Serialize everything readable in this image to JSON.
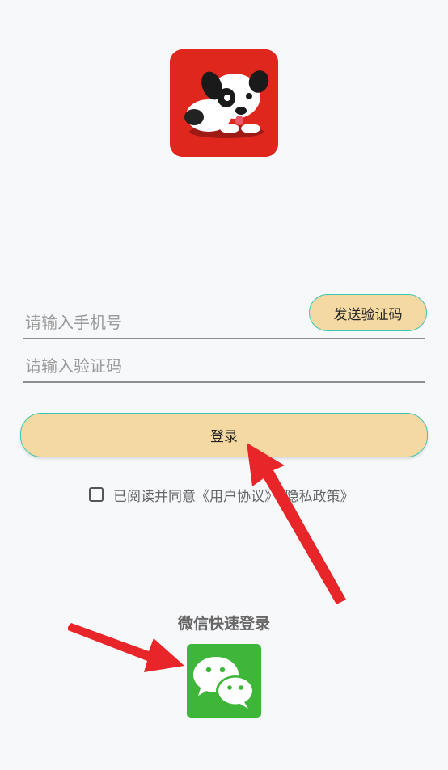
{
  "app": {
    "logo": "puppy-logo"
  },
  "login_form": {
    "phone_placeholder": "请输入手机号",
    "phone_value": "",
    "code_placeholder": "请输入验证码",
    "code_value": "",
    "send_code_label": "发送验证码",
    "login_label": "登录",
    "agreement_text": "已阅读并同意《用户协议》《隐私政策》",
    "agreement_checked": false
  },
  "wechat": {
    "title": "微信快速登录",
    "icon": "wechat-icon"
  },
  "colors": {
    "background": "#f7f8fa",
    "logo_bg": "#e0271e",
    "button_fill": "#f5d9a2",
    "button_border": "#3ec7b3",
    "wechat_green": "#3eb63a",
    "arrow_red": "#e8262a"
  }
}
